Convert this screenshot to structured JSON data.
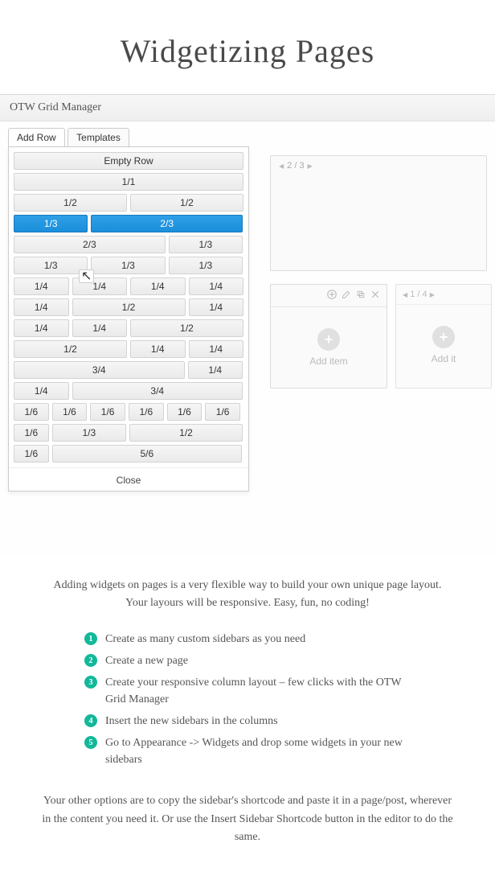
{
  "hero": {
    "title": "Widgetizing Pages"
  },
  "panel": {
    "title": "OTW Grid Manager"
  },
  "tabs": {
    "add_row": "Add Row",
    "templates": "Templates"
  },
  "dropdown": {
    "empty_row": "Empty Row",
    "labels": {
      "l11": "1/1",
      "l12": "1/2",
      "l13": "1/3",
      "l23": "2/3",
      "l14": "1/4",
      "l34": "3/4",
      "l16": "1/6",
      "l56": "5/6"
    },
    "close": "Close"
  },
  "canvas": {
    "pager_top": "2 / 3",
    "pager_side": "1 / 4",
    "add_item": "Add item",
    "add_item_cut": "Add it"
  },
  "description": {
    "line1_a": "Adding widgets on pages is a very flexible way to build your own unique page layout.",
    "line1_b": "Your layours will be responsive. Easy, fun, no coding!"
  },
  "steps": [
    {
      "n": "1",
      "text": "Create as many custom sidebars as you need"
    },
    {
      "n": "2",
      "text": "Create a new page"
    },
    {
      "n": "3",
      "text": "Create your responsive column layout – few clicks with the OTW Grid Manager"
    },
    {
      "n": "4",
      "text": "Insert the new sidebars in the columns"
    },
    {
      "n": "5",
      "text": "Go to Appearance -> Widgets and drop some widgets in your new sidebars"
    }
  ],
  "outro": {
    "text": "Your other options are to copy the sidebar's shortcode and paste it in a page/post, wherever in the content you need it. Or use the Insert Sidebar Shortcode button in the editor to do the same."
  }
}
